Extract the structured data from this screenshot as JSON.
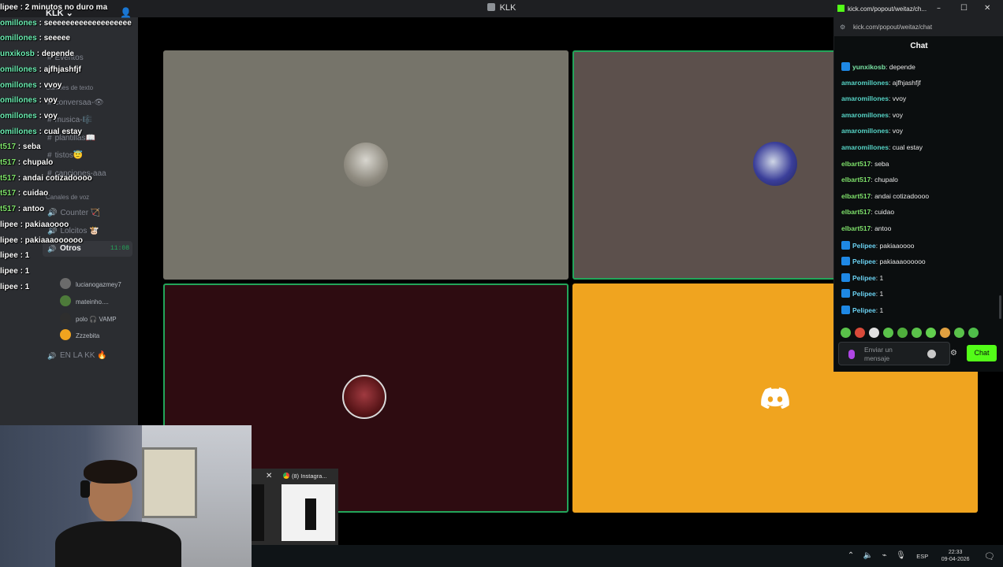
{
  "window": {
    "title": "KLK"
  },
  "sidebar": {
    "server_name": "KLK",
    "items": [
      {
        "kind": "channel",
        "label": "Eventos"
      },
      {
        "kind": "category",
        "label": "Canales de texto"
      },
      {
        "kind": "channel",
        "label": "conversaa-👁"
      },
      {
        "kind": "channel",
        "label": "musica-🎼"
      },
      {
        "kind": "channel",
        "label": "plantillas📖"
      },
      {
        "kind": "channel",
        "label": "tistos😇"
      },
      {
        "kind": "channel",
        "label": "canciones-aaa"
      },
      {
        "kind": "category",
        "label": "Canales de voz"
      },
      {
        "kind": "voice",
        "label": "Counter 🏹"
      },
      {
        "kind": "voice",
        "label": "Lolcitos 🐮"
      },
      {
        "kind": "voice",
        "label": "Mainkraa⛏"
      }
    ],
    "active_voice": {
      "label": "Otros",
      "time": "11:08"
    },
    "members": [
      {
        "name": "lucianogazmey7",
        "color": "#6b6b6b"
      },
      {
        "name": "mateinho....",
        "color": "#4d7a3a"
      },
      {
        "name": "polo 🎧 VAMP",
        "color": "#2e2e2e"
      },
      {
        "name": "Zzzebita",
        "color": "#f0a41f"
      }
    ],
    "bottom_voice": {
      "label": "EN LA KK 🔥"
    }
  },
  "overlay_chat": [
    {
      "user": "lipee",
      "text": " : 2 minutos no duro ma",
      "cls": ""
    },
    {
      "user": "omillones",
      "text": " : seeeeeeeeeeeeeeeeeee",
      "cls": "u"
    },
    {
      "user": "omillones",
      "text": " : seeeee",
      "cls": "u"
    },
    {
      "user": "unxikosb",
      "text": " : depende",
      "cls": "u"
    },
    {
      "user": "omillones",
      "text": " : ajfhjashfjf",
      "cls": "u"
    },
    {
      "user": "omillones",
      "text": " : vvoy",
      "cls": "u"
    },
    {
      "user": "omillones",
      "text": " : voy",
      "cls": "u"
    },
    {
      "user": "omillones",
      "text": " : voy",
      "cls": "u"
    },
    {
      "user": "omillones",
      "text": " : cual estay",
      "cls": "u"
    },
    {
      "user": "t517",
      "text": " : seba",
      "cls": "u2"
    },
    {
      "user": "t517",
      "text": " : chupalo",
      "cls": "u2"
    },
    {
      "user": "t517",
      "text": " : andai cotizadoooo",
      "cls": "u2"
    },
    {
      "user": "t517",
      "text": " : cuidao",
      "cls": "u2"
    },
    {
      "user": "t517",
      "text": " : antoo",
      "cls": "u2"
    },
    {
      "user": "lipee",
      "text": " : pakiaaoooo",
      "cls": ""
    },
    {
      "user": "lipee",
      "text": " : pakiaaaoooooo",
      "cls": ""
    },
    {
      "user": "lipee",
      "text": " : 1",
      "cls": ""
    },
    {
      "user": "lipee",
      "text": " : 1",
      "cls": ""
    },
    {
      "user": "lipee",
      "text": " : 1",
      "cls": ""
    }
  ],
  "kick": {
    "tab_title": "kick.com/popout/weitaz/ch...",
    "url": "kick.com/popout/weitaz/chat",
    "chat_title": "Chat",
    "messages": [
      {
        "user": "yunxikosb",
        "text": ": depende",
        "cls": "kn-y",
        "badge": true
      },
      {
        "user": "amaromillones",
        "text": ": ajfhjashfjf",
        "cls": "kn-a",
        "badge": false
      },
      {
        "user": "amaromillones",
        "text": ": vvoy",
        "cls": "kn-a",
        "badge": false
      },
      {
        "user": "amaromillones",
        "text": ": voy",
        "cls": "kn-a",
        "badge": false
      },
      {
        "user": "amaromillones",
        "text": ": voy",
        "cls": "kn-a",
        "badge": false
      },
      {
        "user": "amaromillones",
        "text": ": cual estay",
        "cls": "kn-a",
        "badge": false
      },
      {
        "user": "elbart517",
        "text": ": seba",
        "cls": "kn-e",
        "badge": false
      },
      {
        "user": "elbart517",
        "text": ": chupalo",
        "cls": "kn-e",
        "badge": false
      },
      {
        "user": "elbart517",
        "text": ": andai cotizadoooo",
        "cls": "kn-e",
        "badge": false
      },
      {
        "user": "elbart517",
        "text": ": cuidao",
        "cls": "kn-e",
        "badge": false
      },
      {
        "user": "elbart517",
        "text": ": antoo",
        "cls": "kn-e",
        "badge": false
      },
      {
        "user": "Pelipee",
        "text": ": pakiaaoooo",
        "cls": "kn-p",
        "badge": true
      },
      {
        "user": "Pelipee",
        "text": ": pakiaaaoooooo",
        "cls": "kn-p",
        "badge": true
      },
      {
        "user": "Pelipee",
        "text": ": 1",
        "cls": "kn-p",
        "badge": true
      },
      {
        "user": "Pelipee",
        "text": ": 1",
        "cls": "kn-p",
        "badge": true
      },
      {
        "user": "Pelipee",
        "text": ": 1",
        "cls": "kn-p",
        "badge": true
      }
    ],
    "input_placeholder": "Enviar un mensaje",
    "send_label": "Chat",
    "accent": "#53fc18"
  },
  "preview": {
    "title": "(8) Instagra..."
  },
  "taskbar": {
    "lang": "ESP",
    "time": "22:33",
    "date": "09-04-2026"
  }
}
